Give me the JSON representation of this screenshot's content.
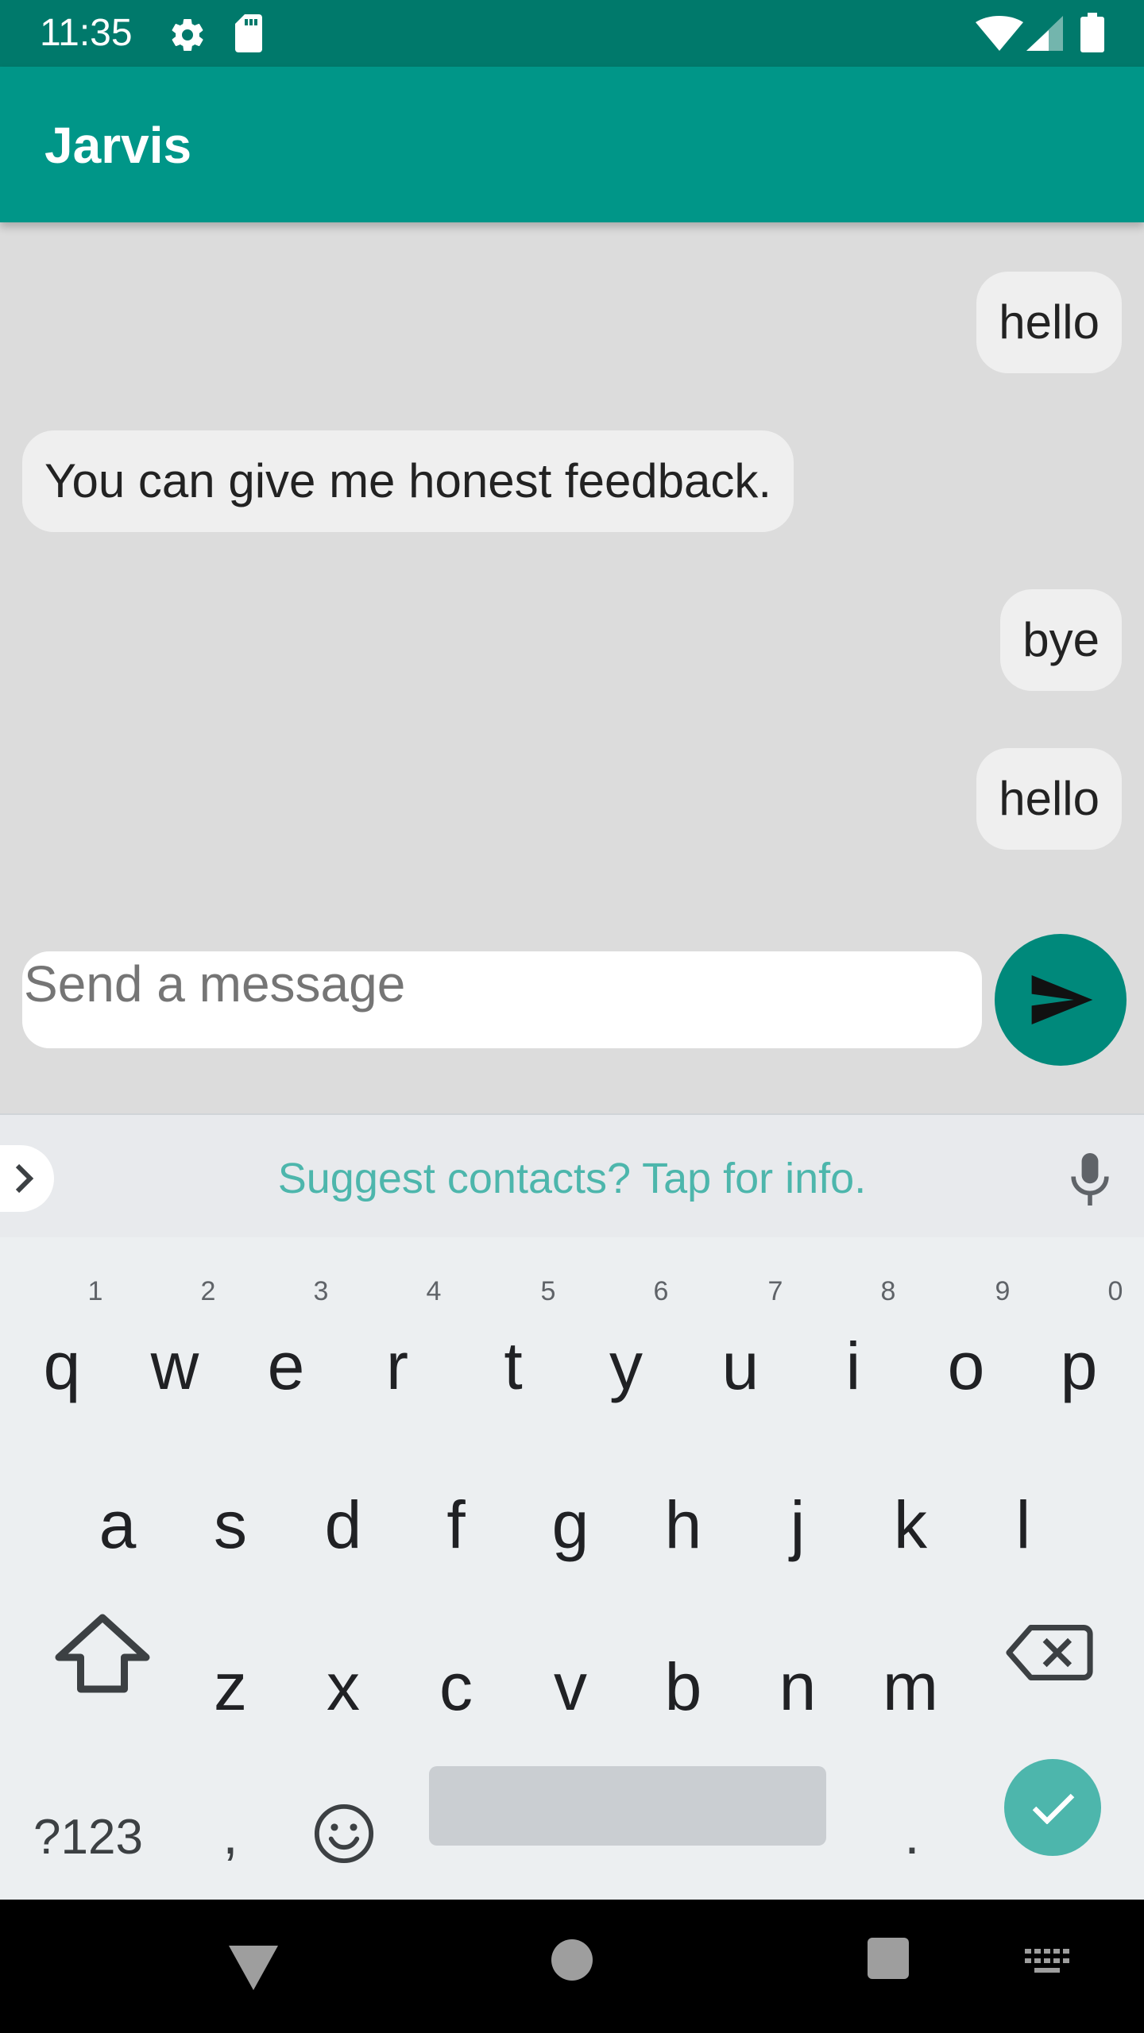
{
  "status_bar": {
    "time": "11:35",
    "icons": [
      "gear-icon",
      "sd-card-icon",
      "wifi-icon",
      "cell-signal-icon",
      "battery-icon"
    ],
    "background": "#00796b"
  },
  "app_bar": {
    "title": "Jarvis",
    "background": "#009688"
  },
  "messages": [
    {
      "sender": "user",
      "text": "hello"
    },
    {
      "sender": "bot",
      "text": "You can give me honest feedback."
    },
    {
      "sender": "user",
      "text": "bye"
    },
    {
      "sender": "user",
      "text": "hello"
    }
  ],
  "composer": {
    "placeholder": "Send a message",
    "value": "",
    "send_icon": "send-icon",
    "accent": "#00897b"
  },
  "keyboard": {
    "suggestion": "Suggest contacts? Tap for info.",
    "row1": [
      "q",
      "w",
      "e",
      "r",
      "t",
      "y",
      "u",
      "i",
      "o",
      "p"
    ],
    "row1_hints": [
      "1",
      "2",
      "3",
      "4",
      "5",
      "6",
      "7",
      "8",
      "9",
      "0"
    ],
    "row2": [
      "a",
      "s",
      "d",
      "f",
      "g",
      "h",
      "j",
      "k",
      "l"
    ],
    "row3": [
      "z",
      "x",
      "c",
      "v",
      "b",
      "n",
      "m"
    ],
    "symbols_label": "?123",
    "comma": ",",
    "period": ".",
    "accent": "#4db6ac"
  },
  "nav_bar": {
    "icons": [
      "back-icon",
      "home-icon",
      "recents-icon",
      "keyboard-switch-icon"
    ]
  }
}
